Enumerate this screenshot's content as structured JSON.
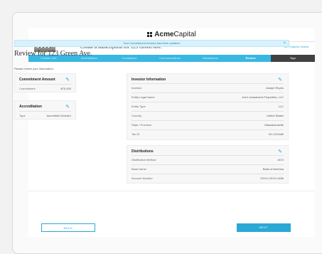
{
  "brand": {
    "name_bold": "Acme",
    "name_rest": "Capital"
  },
  "header": {
    "subtitle": "Create a subscription for 123 Green Ave.",
    "saved_status": "All Progress Saved"
  },
  "steps": [
    {
      "label": "Investor Info"
    },
    {
      "label": "Accreditation"
    },
    {
      "label": "Compliance"
    },
    {
      "label": "Communications"
    },
    {
      "label": "Distributions"
    },
    {
      "label": "Review"
    },
    {
      "label": "Sign"
    }
  ],
  "alert": {
    "text": "Your Commitment Amount has been updated.",
    "close": "×"
  },
  "main": {
    "title": "Review for 123 Green Ave.",
    "intro": "Please review your information:"
  },
  "commitment": {
    "title": "Commitment Amount",
    "label": "Commitment",
    "value": "$75,000"
  },
  "accreditation": {
    "title": "Accreditation",
    "label": "Type",
    "value": "Accredited Investor"
  },
  "investor": {
    "title": "Investor Information",
    "rows": [
      {
        "label": "Investor",
        "value": "Joseph Reyes"
      },
      {
        "label": "Entity Legal Name",
        "value": "Joe's Investment Properties, LLC"
      },
      {
        "label": "Entity Type",
        "value": "LLC"
      },
      {
        "label": "Country",
        "value": "United States"
      },
      {
        "label": "State / Province",
        "value": "Massachusetts"
      },
      {
        "label": "Tax ID",
        "value": "XX-XXX489"
      }
    ]
  },
  "distributions": {
    "title": "Distributions",
    "rows": [
      {
        "label": "Distribution Method",
        "value": "ACH"
      },
      {
        "label": "Bank Name",
        "value": "Bank of America"
      },
      {
        "label": "Account Number",
        "value": "XXXX-XXXX-4456"
      }
    ]
  },
  "buttons": {
    "back": "BACK",
    "next": "NEXT"
  },
  "icons": {
    "edit": "pencil-icon"
  },
  "colors": {
    "accent": "#2aa8d6",
    "sign_step": "#414141"
  }
}
